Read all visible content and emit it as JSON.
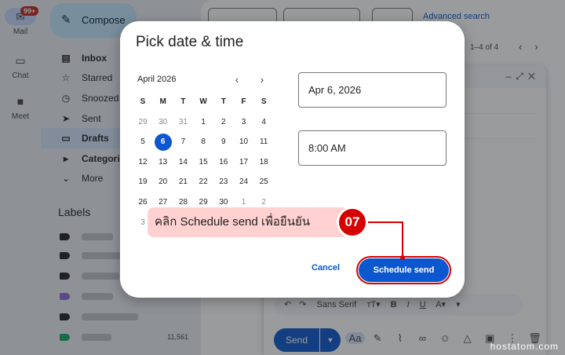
{
  "rail": {
    "mail_badge": "99+",
    "mail_label": "Mail",
    "chat_label": "Chat",
    "meet_label": "Meet"
  },
  "sidebar": {
    "compose_label": "Compose",
    "items": [
      {
        "label": "Inbox",
        "icon": "inbox-icon"
      },
      {
        "label": "Starred",
        "icon": "star-icon"
      },
      {
        "label": "Snoozed",
        "icon": "clock-icon"
      },
      {
        "label": "Sent",
        "icon": "send-icon"
      },
      {
        "label": "Drafts",
        "icon": "draft-icon"
      },
      {
        "label": "Categories",
        "icon": "label-icon"
      },
      {
        "label": "More",
        "icon": "chevron-down-icon"
      }
    ],
    "labels_title": "Labels",
    "label_last_count": "11,561"
  },
  "toolbar": {
    "advanced_search": "Advanced search",
    "pager": "1–4 of 4"
  },
  "compose_window": {
    "font_name": "Sans Serif",
    "send_label": "Send",
    "aa_label": "Aa"
  },
  "dialog": {
    "title": "Pick date & time",
    "month_label": "April 2026",
    "weekday_headers": [
      "S",
      "M",
      "T",
      "W",
      "T",
      "F",
      "S"
    ],
    "weeks": [
      [
        "29",
        "30",
        "31",
        "1",
        "2",
        "3",
        "4"
      ],
      [
        "5",
        "6",
        "7",
        "8",
        "9",
        "10",
        "11"
      ],
      [
        "12",
        "13",
        "14",
        "15",
        "16",
        "17",
        "18"
      ],
      [
        "19",
        "20",
        "21",
        "22",
        "23",
        "24",
        "25"
      ],
      [
        "26",
        "27",
        "28",
        "29",
        "30",
        "1",
        "2"
      ],
      [
        "3"
      ]
    ],
    "selected_day": "6",
    "date_value": "Apr 6, 2026",
    "time_value": "8:00 AM",
    "cancel_label": "Cancel",
    "schedule_label": "Schedule send"
  },
  "annotation": {
    "callout_text": "คลิก Schedule send เพื่อยืนยัน",
    "step_number": "07",
    "watermark": "hostatom.com",
    "highlight_color": "#d50000"
  }
}
